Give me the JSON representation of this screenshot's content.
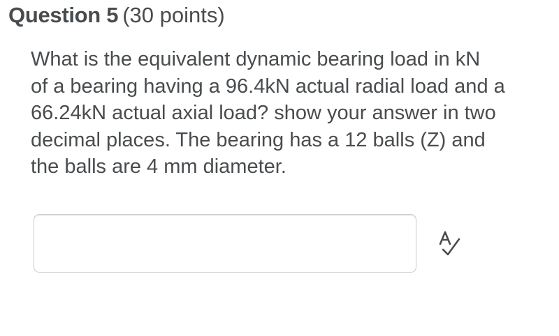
{
  "question": {
    "title": "Question 5",
    "points": "(30 points)",
    "text_lines": [
      "What is the equivalent dynamic bearing load in kN",
      "of a bearing having a 96.4kN actual radial load and a",
      "66.24kN actual axial load? show your answer in two",
      "decimal places. The bearing has a 12 balls (Z) and",
      "the balls are 4 mm diameter."
    ]
  },
  "answer": {
    "value": "",
    "placeholder": ""
  },
  "icons": {
    "spellcheck": "spellcheck-icon"
  },
  "colors": {
    "text": "#494c4e",
    "input_border": "#c8cbcf"
  }
}
